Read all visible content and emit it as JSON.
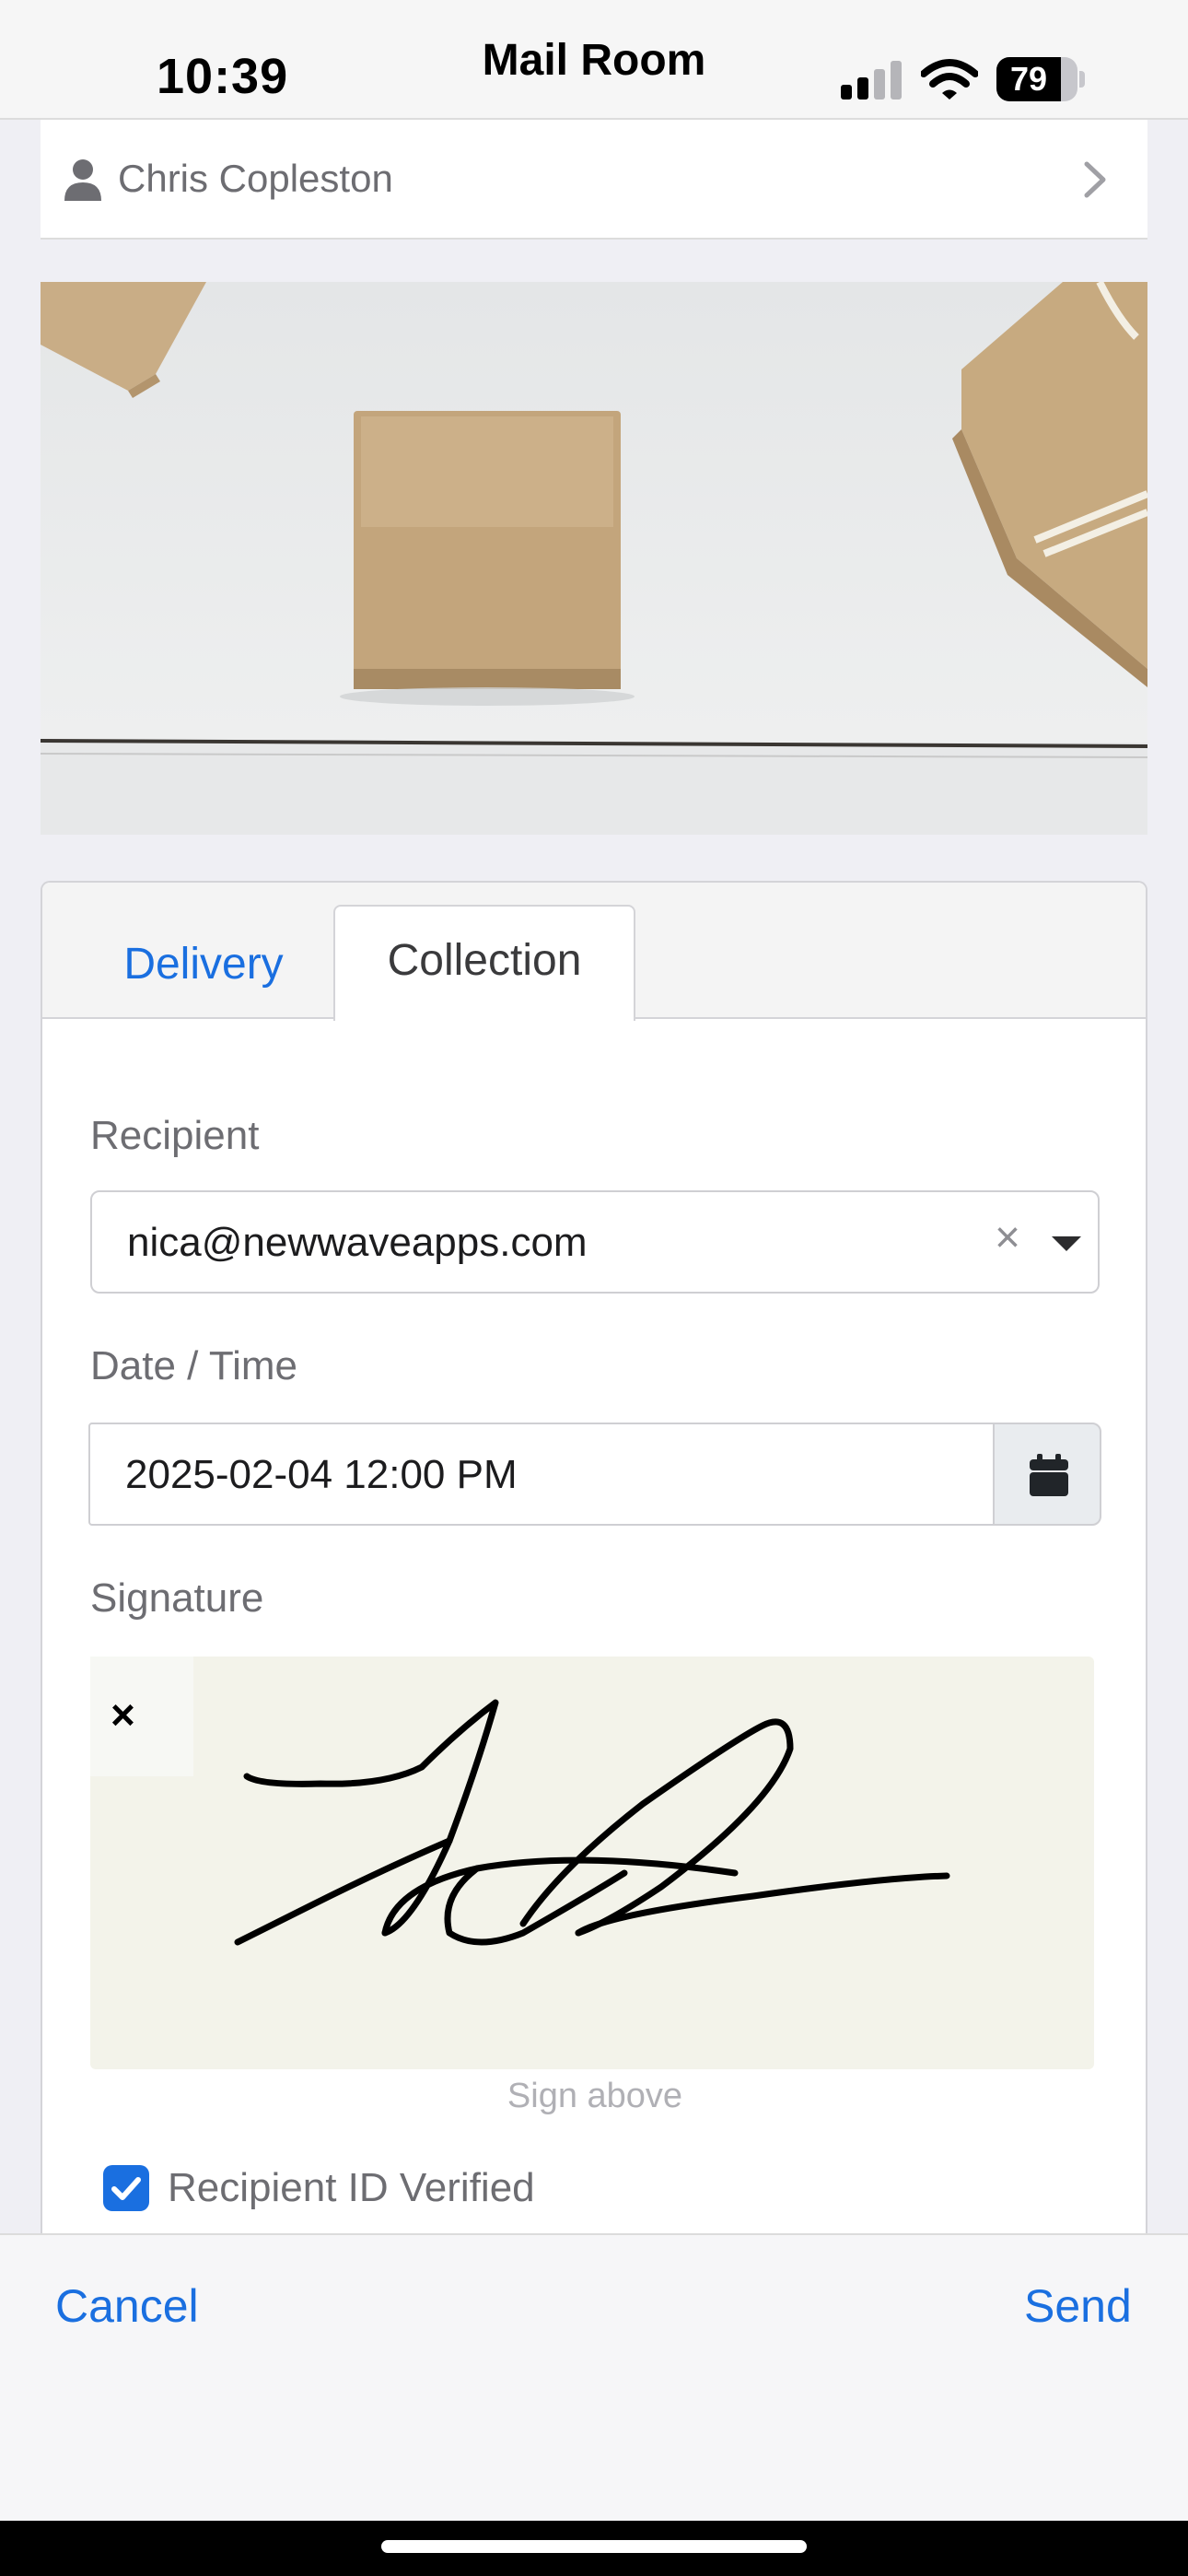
{
  "status_bar": {
    "time": "10:39",
    "battery_level": "79",
    "battery_fraction": 0.79
  },
  "header": {
    "title": "Mail Room"
  },
  "user_row": {
    "name": "Chris Copleston",
    "icon": "person-icon",
    "chevron": "chevron-right-icon"
  },
  "tabs": [
    {
      "label": "Delivery",
      "active": false
    },
    {
      "label": "Collection",
      "active": true
    }
  ],
  "form": {
    "recipient_label": "Recipient",
    "recipient_value": "nica@newwaveapps.com",
    "clear_glyph": "×",
    "datetime_label": "Date / Time",
    "datetime_value": "2025-02-04 12:00 PM",
    "signature_label": "Signature",
    "signature_clear_glyph": "×",
    "signature_hint": "Sign above",
    "verified_label": "Recipient ID Verified",
    "verified_checked": true
  },
  "actions": {
    "cancel_label": "Cancel",
    "send_label": "Send"
  },
  "colors": {
    "accent": "#1a6fe0",
    "background": "#efeff4",
    "signature_pad": "#f3f3ea"
  }
}
